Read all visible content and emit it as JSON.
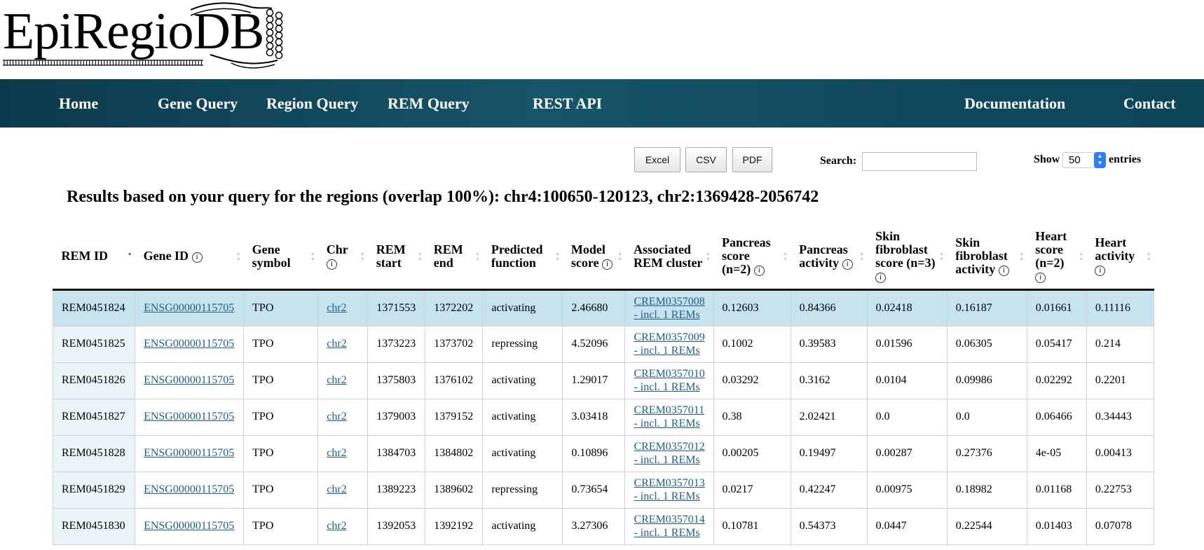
{
  "logo": {
    "text": "EpiRegioDB"
  },
  "nav": {
    "items": [
      {
        "label": "Home"
      },
      {
        "label": "Gene Query"
      },
      {
        "label": "Region Query"
      },
      {
        "label": "REM Query"
      },
      {
        "label": "REST API"
      },
      {
        "label": "Documentation"
      },
      {
        "label": "Contact"
      }
    ],
    "background": "#175468"
  },
  "export_buttons": {
    "excel": "Excel",
    "csv": "CSV",
    "pdf": "PDF"
  },
  "search": {
    "label": "Search:",
    "value": ""
  },
  "page_length": {
    "prefix": "Show",
    "selected": "50",
    "suffix": "entries"
  },
  "heading": "Results based on your query for the regions (overlap 100%): chr4:100650-120123, chr2:1369428-2056742",
  "table": {
    "sorted_column": "REM ID",
    "sort_direction": "ascending",
    "columns": [
      {
        "label": "REM ID",
        "info": false
      },
      {
        "label": "Gene ID",
        "info": true
      },
      {
        "label": "Gene symbol",
        "info": false
      },
      {
        "label": "Chr",
        "info": true
      },
      {
        "label": "REM start",
        "info": false
      },
      {
        "label": "REM end",
        "info": false
      },
      {
        "label": "Predicted function",
        "info": false
      },
      {
        "label": "Model score",
        "info": true
      },
      {
        "label": "Associated REM cluster",
        "info": false
      },
      {
        "label": "Pancreas score (n=2)",
        "info": true
      },
      {
        "label": "Pancreas activity",
        "info": true
      },
      {
        "label": "Skin fibroblast score (n=3)",
        "info": true
      },
      {
        "label": "Skin fibroblast activity",
        "info": true
      },
      {
        "label": "Heart score (n=2)",
        "info": true
      },
      {
        "label": "Heart activity",
        "info": true
      }
    ],
    "info_symbol": "i",
    "rows": [
      {
        "selected": true,
        "rem_id": "REM0451824",
        "gene_id": "ENSG00000115705",
        "gene_symbol": "TPO",
        "chr": "chr2",
        "start": "1371553",
        "end": "1372202",
        "function": "activating",
        "model_score": "2.46680",
        "cluster_id": "CREM0357008",
        "cluster_note": "- incl. 1 REMs",
        "pancreas_score": "0.12603",
        "pancreas_activity": "0.84366",
        "skin_score": "0.02418",
        "skin_activity": "0.16187",
        "heart_score": "0.01661",
        "heart_activity": "0.11116"
      },
      {
        "selected": false,
        "rem_id": "REM0451825",
        "gene_id": "ENSG00000115705",
        "gene_symbol": "TPO",
        "chr": "chr2",
        "start": "1373223",
        "end": "1373702",
        "function": "repressing",
        "model_score": "4.52096",
        "cluster_id": "CREM0357009",
        "cluster_note": "- incl. 1 REMs",
        "pancreas_score": "0.1002",
        "pancreas_activity": "0.39583",
        "skin_score": "0.01596",
        "skin_activity": "0.06305",
        "heart_score": "0.05417",
        "heart_activity": "0.214"
      },
      {
        "selected": false,
        "rem_id": "REM0451826",
        "gene_id": "ENSG00000115705",
        "gene_symbol": "TPO",
        "chr": "chr2",
        "start": "1375803",
        "end": "1376102",
        "function": "activating",
        "model_score": "1.29017",
        "cluster_id": "CREM0357010",
        "cluster_note": "- incl. 1 REMs",
        "pancreas_score": "0.03292",
        "pancreas_activity": "0.3162",
        "skin_score": "0.0104",
        "skin_activity": "0.09986",
        "heart_score": "0.02292",
        "heart_activity": "0.2201"
      },
      {
        "selected": false,
        "rem_id": "REM0451827",
        "gene_id": "ENSG00000115705",
        "gene_symbol": "TPO",
        "chr": "chr2",
        "start": "1379003",
        "end": "1379152",
        "function": "activating",
        "model_score": "3.03418",
        "cluster_id": "CREM0357011",
        "cluster_note": "- incl. 1 REMs",
        "pancreas_score": "0.38",
        "pancreas_activity": "2.02421",
        "skin_score": "0.0",
        "skin_activity": "0.0",
        "heart_score": "0.06466",
        "heart_activity": "0.34443"
      },
      {
        "selected": false,
        "rem_id": "REM0451828",
        "gene_id": "ENSG00000115705",
        "gene_symbol": "TPO",
        "chr": "chr2",
        "start": "1384703",
        "end": "1384802",
        "function": "activating",
        "model_score": "0.10896",
        "cluster_id": "CREM0357012",
        "cluster_note": "- incl. 1 REMs",
        "pancreas_score": "0.00205",
        "pancreas_activity": "0.19497",
        "skin_score": "0.00287",
        "skin_activity": "0.27376",
        "heart_score": "4e-05",
        "heart_activity": "0.00413"
      },
      {
        "selected": false,
        "rem_id": "REM0451829",
        "gene_id": "ENSG00000115705",
        "gene_symbol": "TPO",
        "chr": "chr2",
        "start": "1389223",
        "end": "1389602",
        "function": "repressing",
        "model_score": "0.73654",
        "cluster_id": "CREM0357013",
        "cluster_note": "- incl. 1 REMs",
        "pancreas_score": "0.0217",
        "pancreas_activity": "0.42247",
        "skin_score": "0.00975",
        "skin_activity": "0.18982",
        "heart_score": "0.01168",
        "heart_activity": "0.22753"
      },
      {
        "selected": false,
        "rem_id": "REM0451830",
        "gene_id": "ENSG00000115705",
        "gene_symbol": "TPO",
        "chr": "chr2",
        "start": "1392053",
        "end": "1392192",
        "function": "activating",
        "model_score": "3.27306",
        "cluster_id": "CREM0357014",
        "cluster_note": "- incl. 1 REMs",
        "pancreas_score": "0.10781",
        "pancreas_activity": "0.54373",
        "skin_score": "0.0447",
        "skin_activity": "0.22544",
        "heart_score": "0.01403",
        "heart_activity": "0.07078"
      }
    ]
  }
}
